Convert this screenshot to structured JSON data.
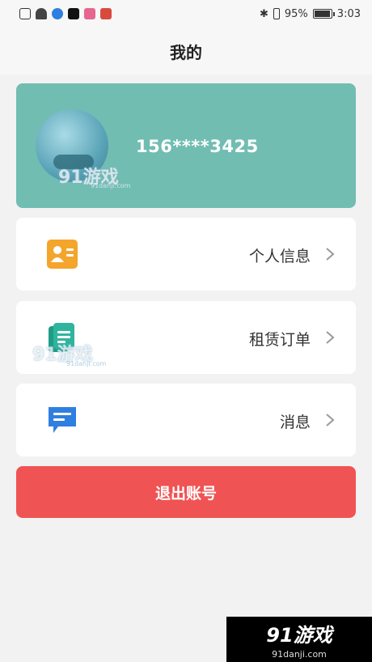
{
  "status_bar": {
    "battery": "95%",
    "time": "3:03"
  },
  "header": {
    "title": "我的"
  },
  "profile": {
    "phone": "156****3425"
  },
  "menu": [
    {
      "label": "个人信息",
      "icon": "id-card-icon",
      "color": "#f4a52c"
    },
    {
      "label": "租赁订单",
      "icon": "document-icon",
      "color": "#2fb59e"
    },
    {
      "label": "消息",
      "icon": "message-icon",
      "color": "#2f7fe0"
    }
  ],
  "logout": {
    "label": "退出账号",
    "color": "#f05353"
  },
  "watermark": {
    "brand": "91游戏",
    "url": "91danji.com"
  },
  "colors": {
    "profile_bg": "#71bdb2",
    "page_bg": "#f2f2f2"
  }
}
